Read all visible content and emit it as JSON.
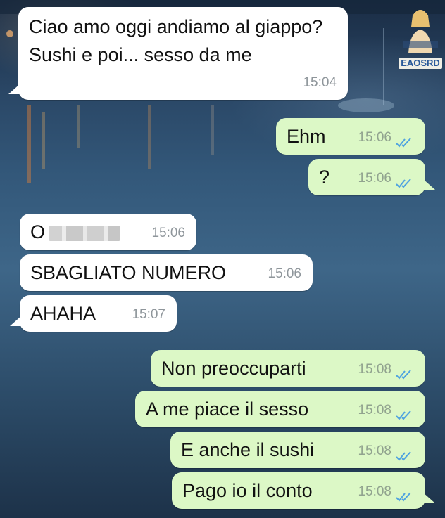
{
  "watermark": {
    "label": "EAOSRD"
  },
  "messages": [
    {
      "direction": "incoming",
      "text": "Ciao amo oggi andiamo al giappo? Sushi e poi... sesso da me",
      "time": "15:04"
    },
    {
      "direction": "outgoing",
      "text": "Ehm",
      "time": "15:06",
      "status": "read"
    },
    {
      "direction": "outgoing",
      "text": "?",
      "time": "15:06",
      "status": "read"
    },
    {
      "direction": "incoming",
      "text": "O",
      "time": "15:06",
      "redacted": true
    },
    {
      "direction": "incoming",
      "text": "SBAGLIATO NUMERO",
      "time": "15:06"
    },
    {
      "direction": "incoming",
      "text": "AHAHA",
      "time": "15:07"
    },
    {
      "direction": "outgoing",
      "text": "Non preoccuparti",
      "time": "15:08",
      "status": "read"
    },
    {
      "direction": "outgoing",
      "text": "A me piace il sesso",
      "time": "15:08",
      "status": "read"
    },
    {
      "direction": "outgoing",
      "text": "E anche il sushi",
      "time": "15:08",
      "status": "read"
    },
    {
      "direction": "outgoing",
      "text": "Pago io il conto",
      "time": "15:08",
      "status": "read"
    }
  ],
  "colors": {
    "incoming_bubble": "#ffffff",
    "outgoing_bubble": "#dcf8c6",
    "read_ticks": "#4fa3e0"
  },
  "icons": {
    "read_status": "double-check-icon"
  }
}
